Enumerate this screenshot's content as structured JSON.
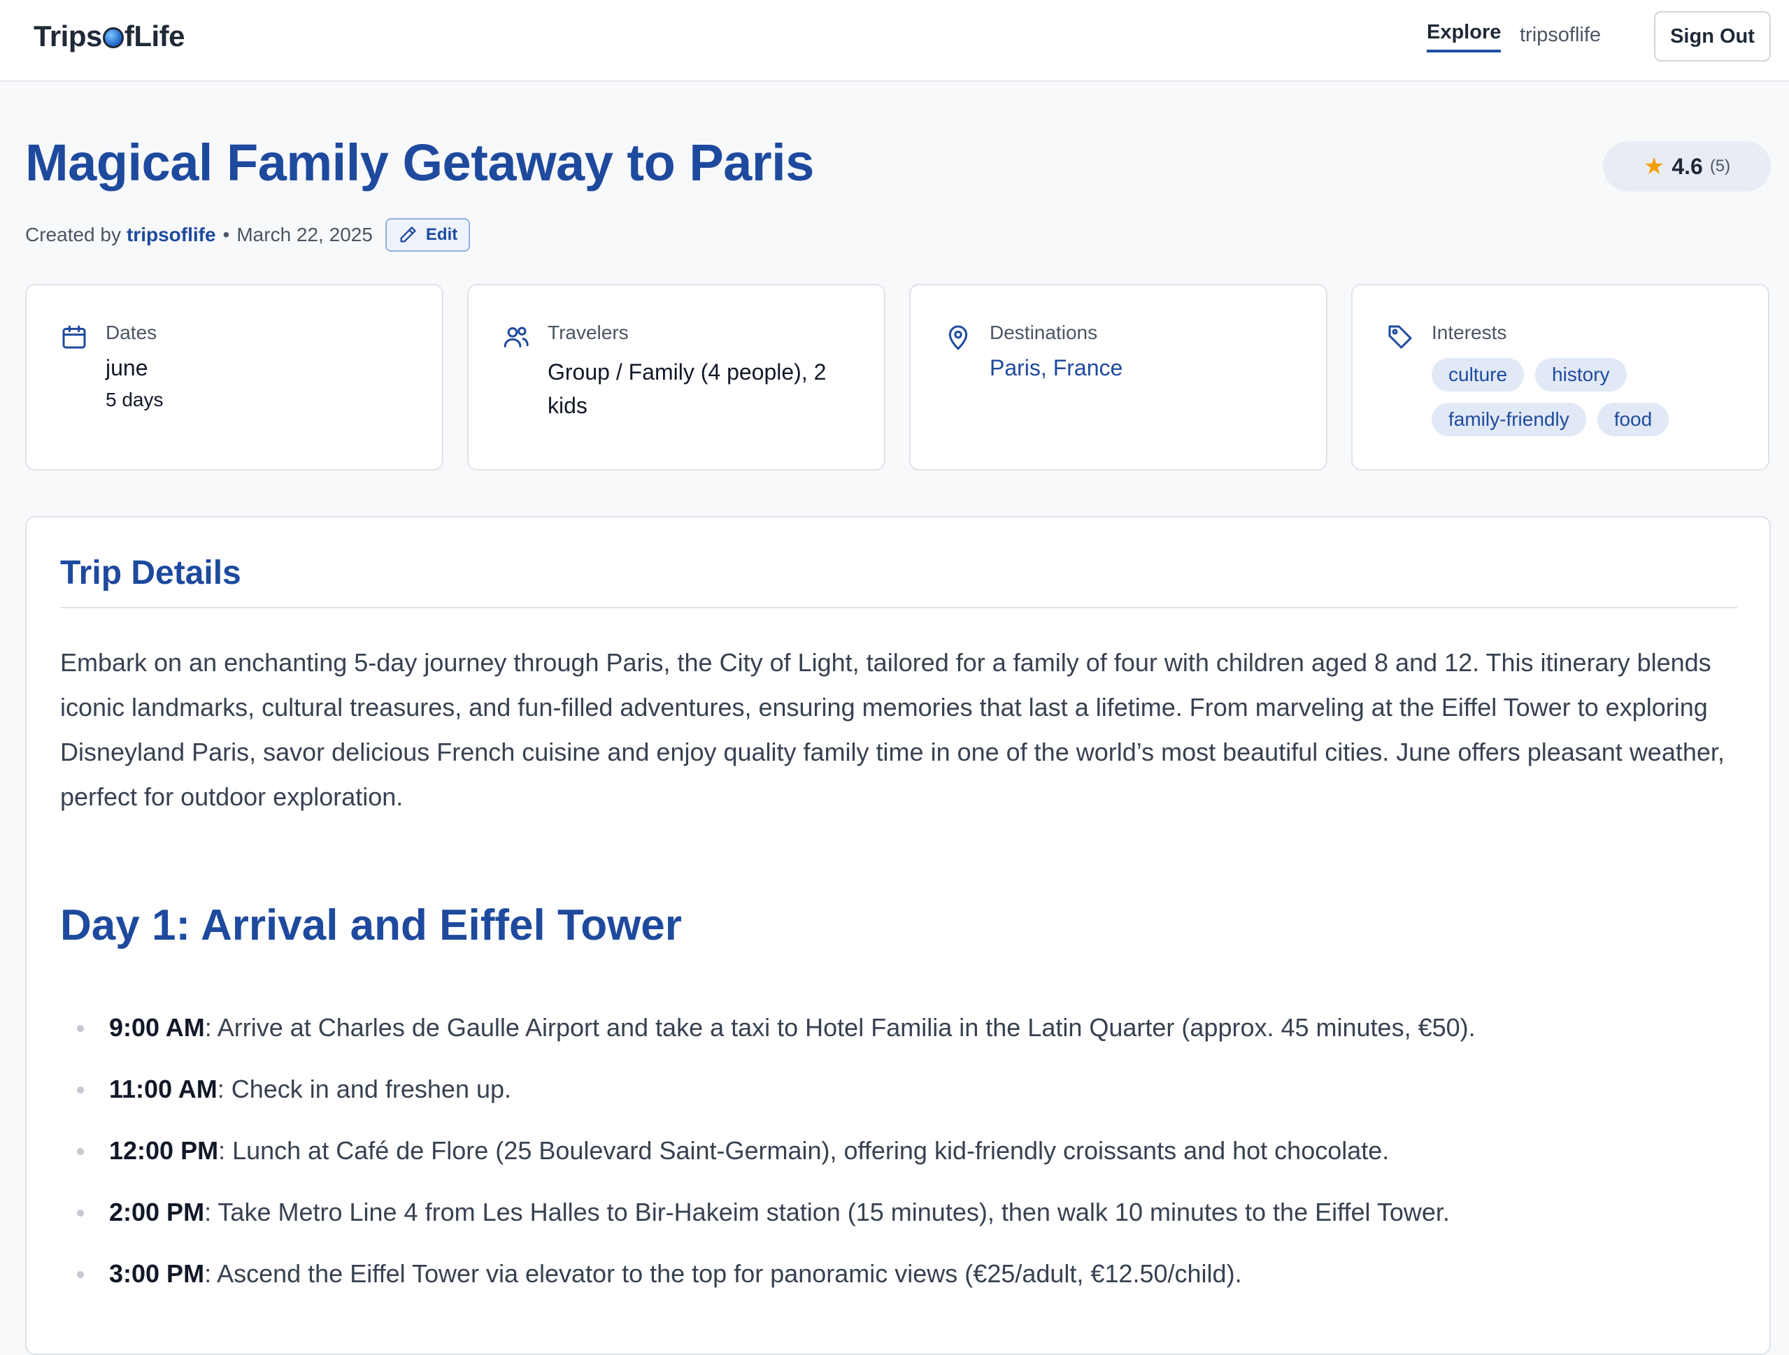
{
  "header": {
    "logo_pre": "Trips",
    "logo_post": "fLife",
    "nav_explore": "Explore",
    "nav_user": "tripsoflife",
    "sign_out": "Sign Out"
  },
  "trip": {
    "title": "Magical Family Getaway to Paris",
    "rating": "4.6",
    "rating_count": "(5)",
    "created_by_label": "Created by",
    "author": "tripsoflife",
    "separator": "•",
    "date": "March 22, 2025",
    "edit_label": "Edit"
  },
  "cards": {
    "dates": {
      "label": "Dates",
      "value": "june",
      "sub": "5 days",
      "icon": "calendar-icon"
    },
    "travelers": {
      "label": "Travelers",
      "value": "Group / Family (4 people), 2 kids",
      "icon": "users-icon"
    },
    "destinations": {
      "label": "Destinations",
      "value": "Paris, France",
      "icon": "map-pin-icon"
    },
    "interests": {
      "label": "Interests",
      "tags": [
        "culture",
        "history",
        "family-friendly",
        "food"
      ],
      "icon": "tag-icon"
    }
  },
  "details": {
    "heading": "Trip Details",
    "intro": "Embark on an enchanting 5-day journey through Paris, the City of Light, tailored for a family of four with children aged 8 and 12. This itinerary blends iconic landmarks, cultural treasures, and fun-filled adventures, ensuring memories that last a lifetime. From marveling at the Eiffel Tower to exploring Disneyland Paris, savor delicious French cuisine and enjoy quality family time in one of the world’s most beautiful cities. June offers pleasant weather, perfect for outdoor exploration.",
    "day1_heading": "Day 1: Arrival and Eiffel Tower",
    "schedule": [
      {
        "time": "9:00 AM",
        "text": ": Arrive at Charles de Gaulle Airport and take a taxi to Hotel Familia in the Latin Quarter (approx. 45 minutes, €50)."
      },
      {
        "time": "11:00 AM",
        "text": ": Check in and freshen up."
      },
      {
        "time": "12:00 PM",
        "text": ": Lunch at Café de Flore (25 Boulevard Saint-Germain), offering kid-friendly croissants and hot chocolate."
      },
      {
        "time": "2:00 PM",
        "text": ": Take Metro Line 4 from Les Halles to Bir-Hakeim station (15 minutes), then walk 10 minutes to the Eiffel Tower."
      },
      {
        "time": "3:00 PM",
        "text": ": Ascend the Eiffel Tower via elevator to the top for panoramic views (€25/adult, €12.50/child)."
      }
    ]
  },
  "colors": {
    "brand": "#1e4a9e",
    "tag_bg": "#e1e9f6",
    "star": "#f59e0b"
  }
}
